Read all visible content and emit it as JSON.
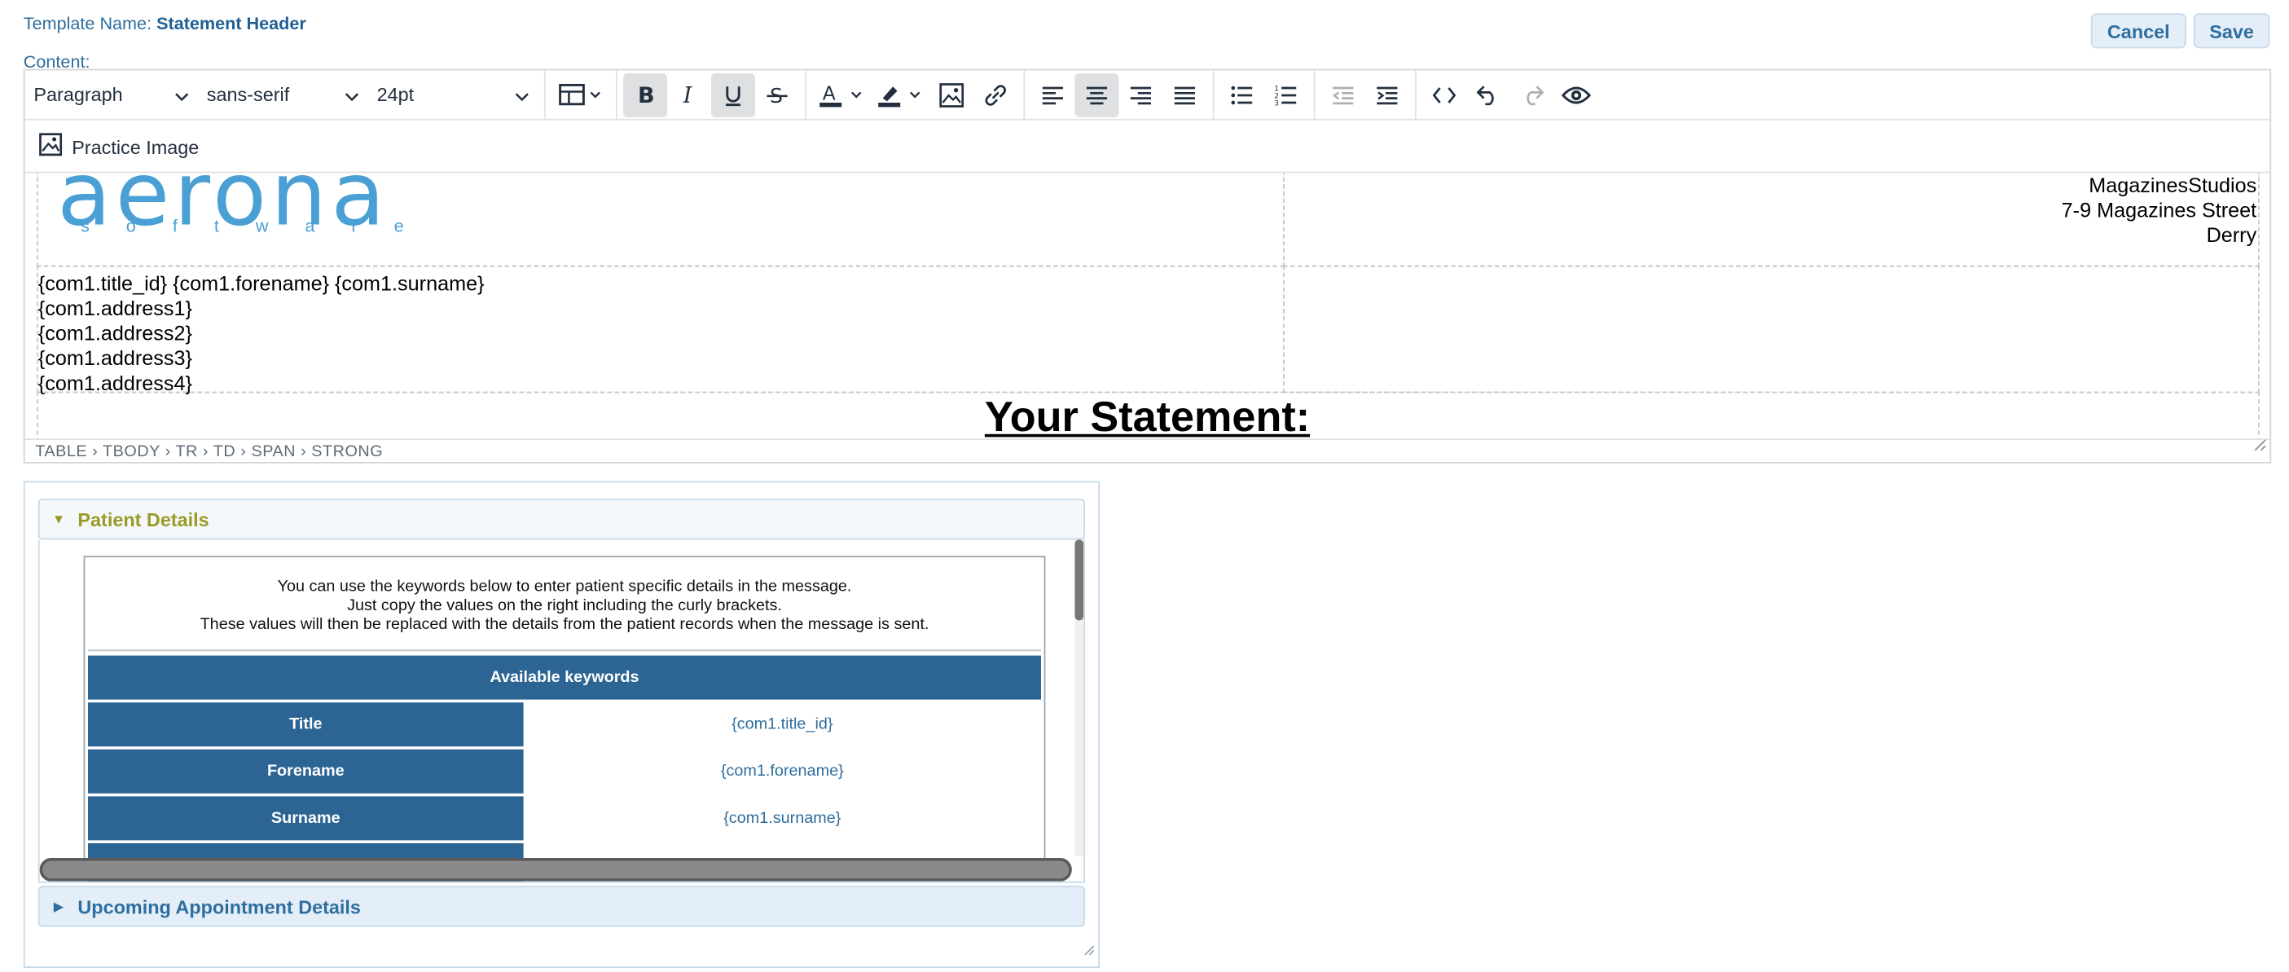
{
  "header": {
    "template_name_label": "Template Name:",
    "template_name_value": "Statement Header",
    "content_label": "Content:",
    "cancel_label": "Cancel",
    "save_label": "Save"
  },
  "toolbar": {
    "block_format": "Paragraph",
    "font_family": "sans-serif",
    "font_size": "24pt",
    "practice_image_label": "Practice Image",
    "icons": [
      "table-icon",
      "bold-icon",
      "italic-icon",
      "underline-icon",
      "strikethrough-icon",
      "text-color-icon",
      "highlight-icon",
      "image-icon",
      "link-icon",
      "align-left-icon",
      "align-center-icon",
      "align-right-icon",
      "align-justify-icon",
      "bullet-list-icon",
      "numbered-list-icon",
      "outdent-icon",
      "indent-icon",
      "code-icon",
      "undo-icon",
      "redo-icon",
      "preview-icon"
    ]
  },
  "document": {
    "logo_text": "aerona",
    "logo_subtext": "software",
    "address_lines": [
      "MagazinesStudios",
      "7-9 Magazines Street",
      "Derry"
    ],
    "patient_lines": [
      "{com1.title_id} {com1.forename} {com1.surname}",
      "{com1.address1}",
      "{com1.address2}",
      "{com1.address3}",
      "{com1.address4}"
    ],
    "statement_title": "Your Statement:"
  },
  "statusbar": {
    "path": "TABLE › TBODY › TR › TD › SPAN › STRONG"
  },
  "accordion": {
    "patient_details_title": "Patient Details",
    "upcoming_title": "Upcoming Appointment Details",
    "info_lines": [
      "You can use the keywords below to enter patient specific details in the message.",
      "Just copy the values on the right including the curly brackets.",
      "These values will then be replaced with the details from the patient records when the message is sent."
    ],
    "keywords_header": "Available keywords",
    "keywords": [
      {
        "key": "Title",
        "value": "{com1.title_id}"
      },
      {
        "key": "Forename",
        "value": "{com1.forename}"
      },
      {
        "key": "Surname",
        "value": "{com1.surname}"
      }
    ]
  },
  "colors": {
    "accent": "#2e6e9e",
    "table_header": "#2c6594",
    "active_accordion": "#9a9a25"
  }
}
